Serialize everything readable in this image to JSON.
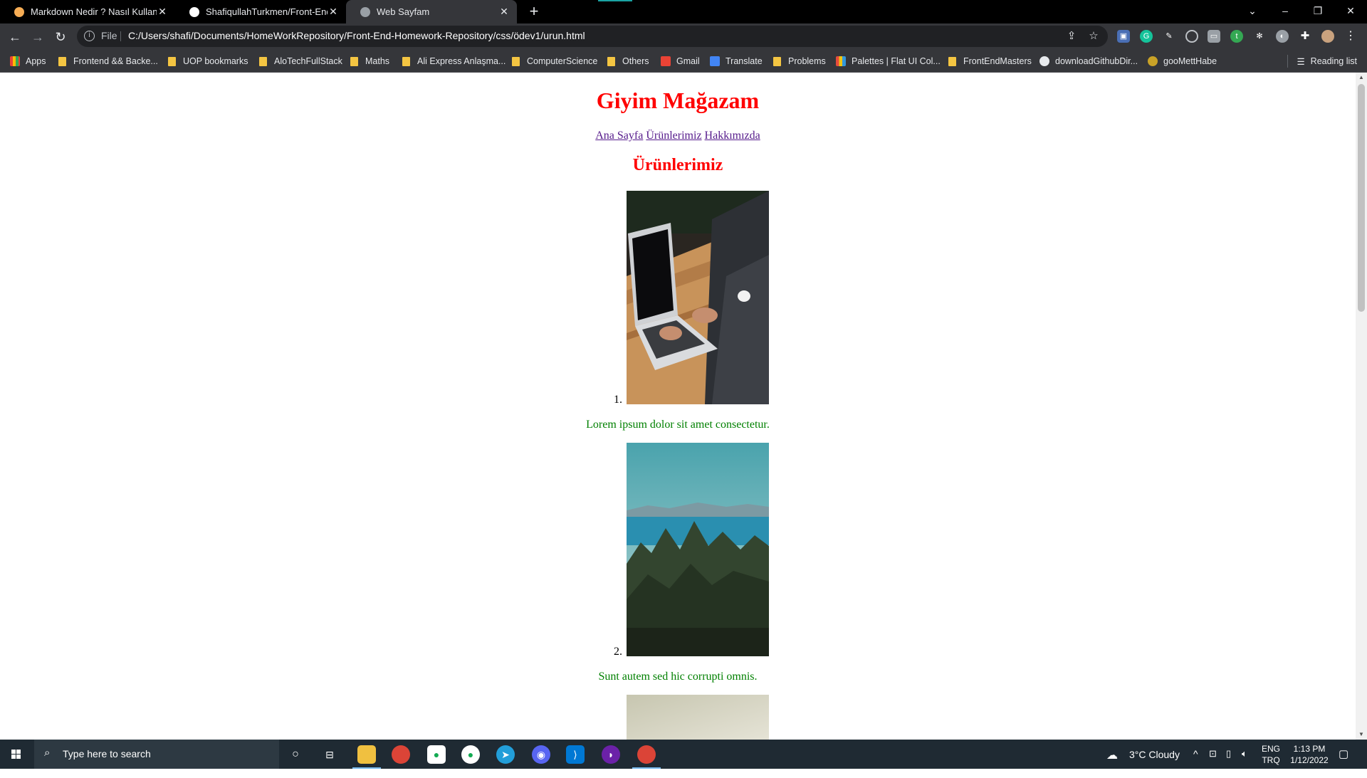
{
  "browser": {
    "tabs": [
      {
        "title": "Markdown Nedir ? Nasıl Kullanılır",
        "color": "#f6ad55"
      },
      {
        "title": "ShafiqullahTurkmen/Front-End-H",
        "color": "#ffffff"
      },
      {
        "title": "Web Sayfam",
        "color": "#9aa0a6"
      }
    ],
    "omnibox": {
      "scheme": "File",
      "url": "C:/Users/shafi/Documents/HomeWorkRepository/Front-End-Homework-Repository/css/ödev1/urun.html"
    },
    "bookmarks": [
      "Apps",
      "Frontend && Backe...",
      "UOP bookmarks",
      "AloTechFullStack",
      "Maths",
      "Ali Express Anlaşma...",
      "ComputerScience",
      "Others",
      "Gmail",
      "Translate",
      "Problems",
      "Palettes | Flat UI Col...",
      "FrontEndMasters",
      "downloadGithubDir...",
      "gooMettHabe"
    ],
    "reading_list": "Reading list"
  },
  "page": {
    "title": "Giyim Mağazam",
    "nav": [
      "Ana Sayfa",
      "Ürünlerimiz",
      "Hakkımızda"
    ],
    "section_title": "Ürünlerimiz",
    "products": [
      {
        "number": "1.",
        "caption": "Lorem ipsum dolor sit amet consectetur."
      },
      {
        "number": "2.",
        "caption": "Sunt autem sed hic corrupti omnis."
      }
    ]
  },
  "taskbar": {
    "search_placeholder": "Type here to search",
    "weather": "3°C  Cloudy",
    "lang_top": "ENG",
    "lang_bottom": "TRQ",
    "time": "1:13 PM",
    "date": "1/12/2022"
  }
}
